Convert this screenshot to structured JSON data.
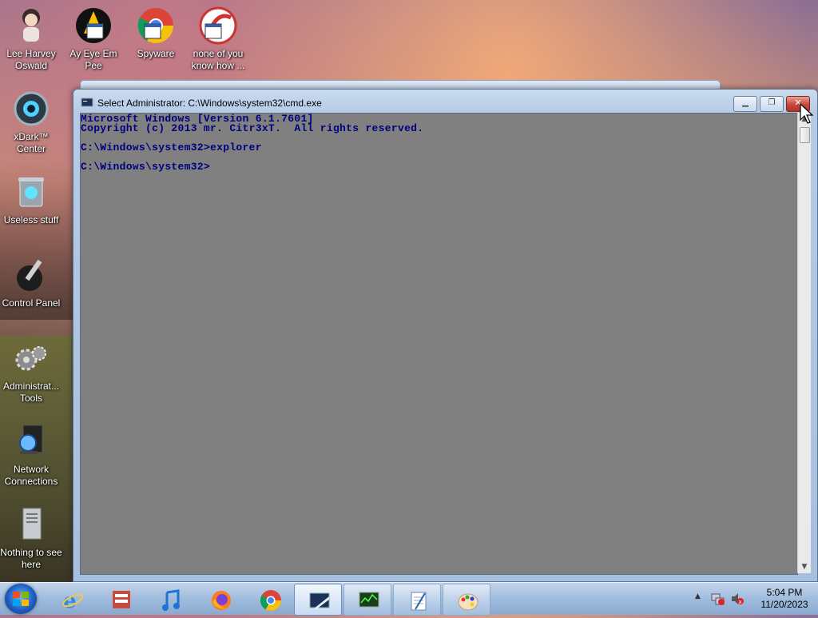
{
  "desktop": {
    "icons": [
      {
        "label": "Lee Harvey Oswald",
        "icon": "anime-character-icon"
      },
      {
        "label": "Ay Eye Em Pee",
        "icon": "aim-shortcut-icon"
      },
      {
        "label": "Spyware",
        "icon": "chrome-shortcut-icon"
      },
      {
        "label": "none of you know how ...",
        "icon": "shortcut-icon"
      },
      {
        "label": "xDark™ Center",
        "icon": "eye-orb-icon"
      },
      {
        "label": "Useless stuff",
        "icon": "recycle-bin-icon"
      },
      {
        "label": "Control Panel",
        "icon": "control-panel-icon"
      },
      {
        "label": "Administrat... Tools",
        "icon": "gears-icon"
      },
      {
        "label": "Network Connections",
        "icon": "network-icon"
      },
      {
        "label": "Nothing to see here",
        "icon": "server-icon"
      }
    ]
  },
  "window": {
    "title": "Select Administrator: C:\\Windows\\system32\\cmd.exe",
    "console_lines": [
      "Microsoft Windows [Version 6.1.7601]",
      "Copyright (c) 2013 mr. Citr3xT.  All rights reserved.",
      "",
      "C:\\Windows\\system32>explorer",
      "",
      "C:\\Windows\\system32>"
    ],
    "console_bg": "#808080",
    "console_fg": "#000080"
  },
  "taskbar": {
    "pinned": [
      "internet-explorer-icon",
      "files-icon",
      "music-note-icon",
      "firefox-icon",
      "chrome-icon",
      "cmd-icon",
      "task-manager-icon",
      "notepad-icon",
      "paint-icon"
    ],
    "clock_time": "5:04 PM",
    "clock_date": "11/20/2023"
  }
}
